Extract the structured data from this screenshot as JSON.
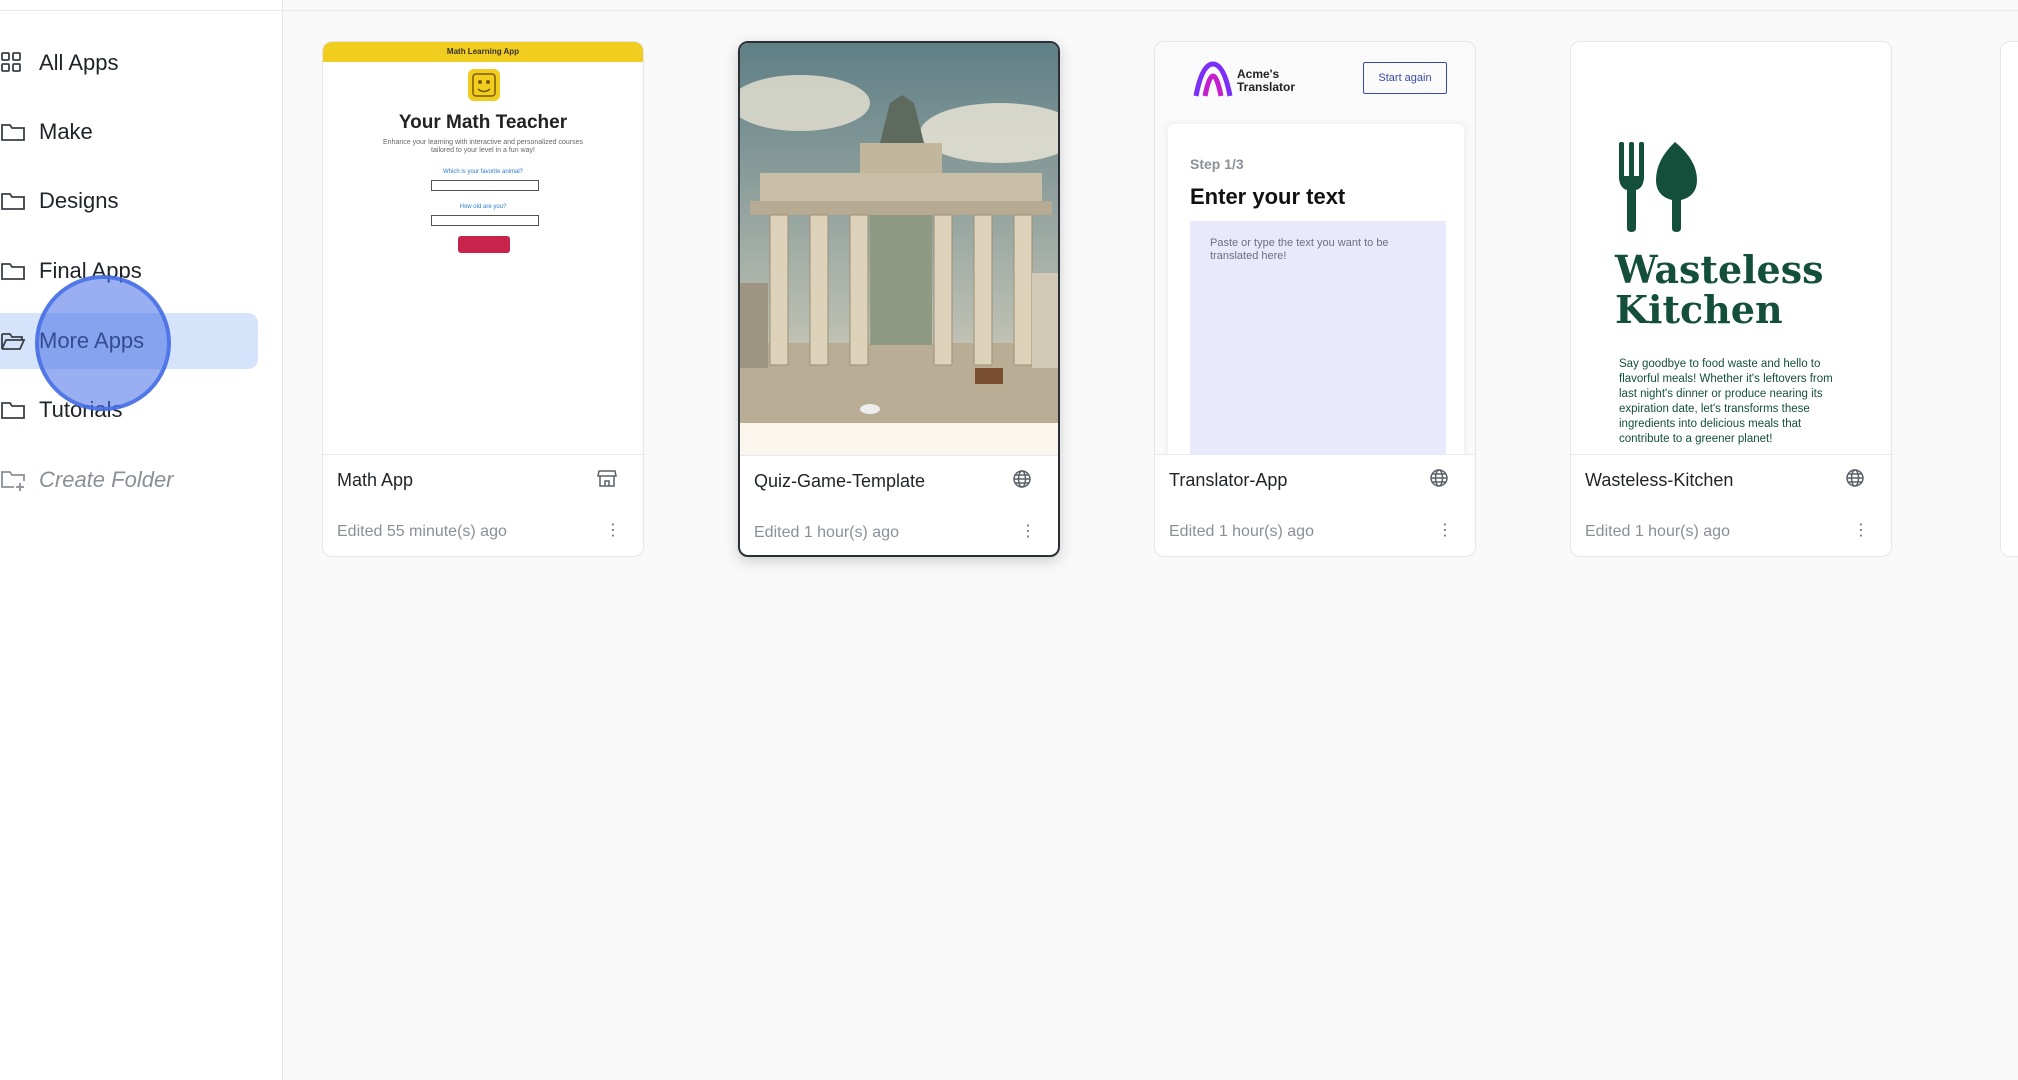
{
  "sidebar": {
    "items": [
      {
        "label": "All Apps",
        "icon": "grid-icon"
      },
      {
        "label": "Make",
        "icon": "folder-icon"
      },
      {
        "label": "Designs",
        "icon": "folder-icon"
      },
      {
        "label": "Final Apps",
        "icon": "folder-icon"
      },
      {
        "label": "More Apps",
        "icon": "folder-open-icon",
        "active": true
      },
      {
        "label": "Tutorials",
        "icon": "folder-icon"
      },
      {
        "label": "Create Folder",
        "icon": "folder-plus-icon"
      }
    ]
  },
  "apps": [
    {
      "title": "Math App",
      "edited": "Edited 55 minute(s) ago",
      "type_icon": "store-icon",
      "preview": {
        "header": "Math Learning App",
        "heading": "Your Math Teacher",
        "subtitle": "Enhance your learning with interactive and personalized courses tailored to your level in a fun way!",
        "q1": "Which is your favorite animal?",
        "q2": "How old are you?"
      }
    },
    {
      "title": "Quiz-Game-Template",
      "edited": "Edited 1 hour(s) ago",
      "type_icon": "globe-icon",
      "preview": {
        "image": "city-gate-photo"
      }
    },
    {
      "title": "Translator-App",
      "edited": "Edited 1 hour(s) ago",
      "type_icon": "globe-icon",
      "preview": {
        "brand": "Acme's Translator",
        "button": "Start again",
        "step": "Step 1/3",
        "heading": "Enter your text",
        "placeholder": "Paste or type the text you want to be translated here!"
      }
    },
    {
      "title": "Wasteless-Kitchen",
      "edited": "Edited 1 hour(s) ago",
      "type_icon": "globe-icon",
      "preview": {
        "heading": "Wasteless Kitchen",
        "body": "Say goodbye to food waste and hello to flavorful meals! Whether it's leftovers from last night's dinner or produce nearing its expiration date, let's transforms these ingredients into delicious meals that contribute to a greener planet!"
      }
    }
  ],
  "colors": {
    "active_bg": "#d6e4fb",
    "click_ring": "#466ee6",
    "math_yellow": "#f1cd1f",
    "math_button": "#c8234a",
    "translator_accent": "#3a4aa8",
    "kitchen_green": "#134f3b"
  }
}
